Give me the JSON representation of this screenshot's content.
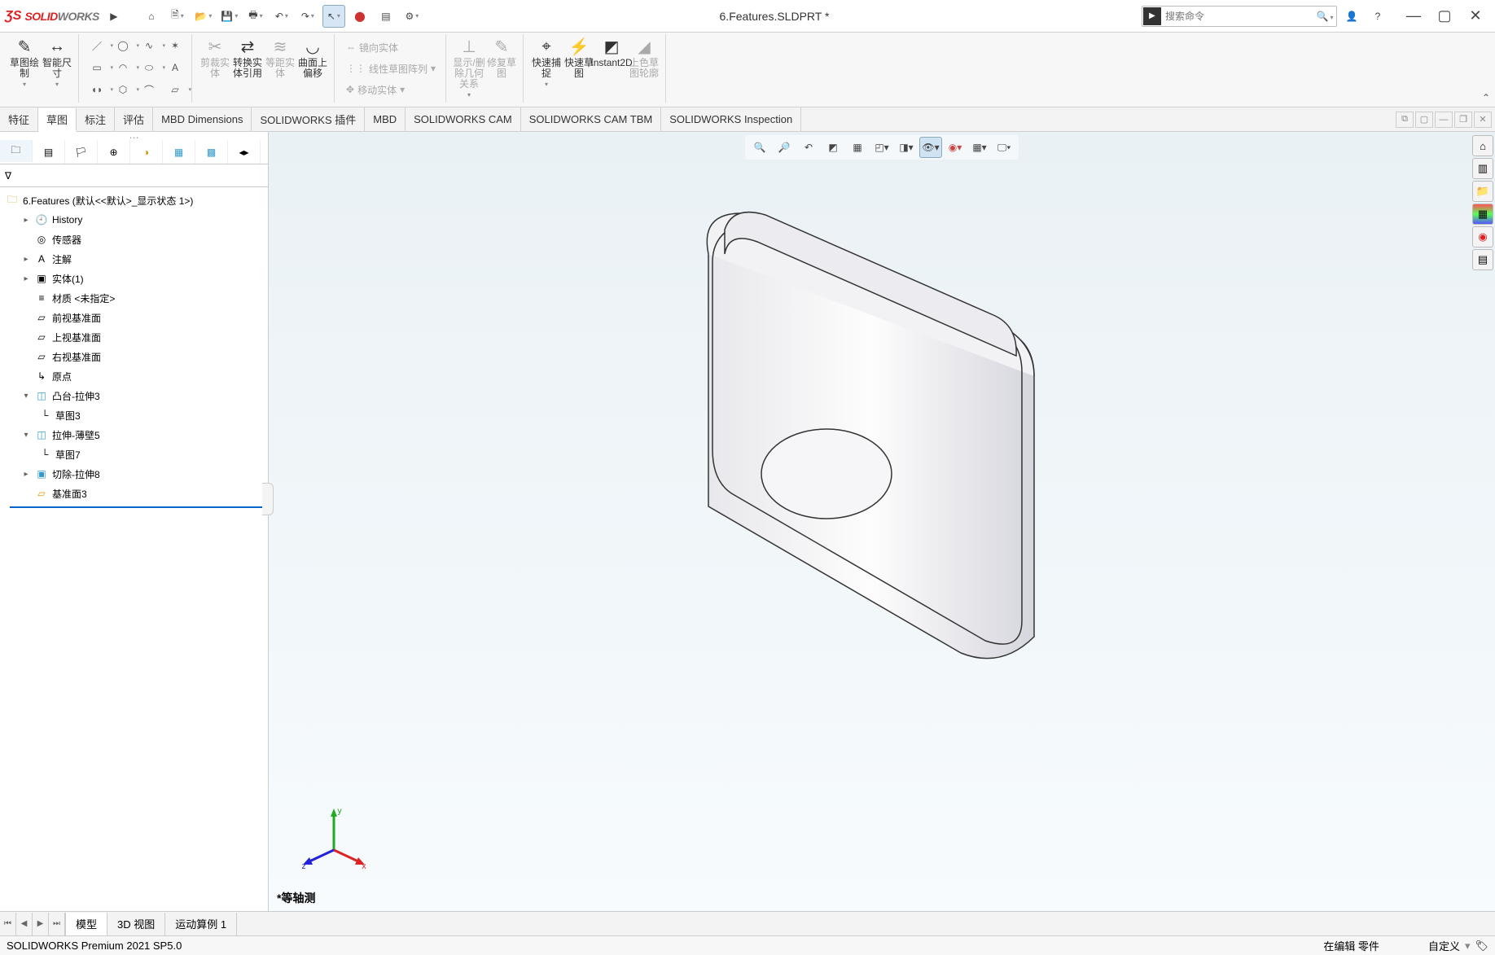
{
  "app_name_1": "SOLID",
  "app_name_2": "WORKS",
  "document_title": "6.Features.SLDPRT *",
  "search_placeholder": "搜索命令",
  "ribbon": {
    "sketch": "草图绘制",
    "smart_dim": "智能尺寸",
    "trim": "剪裁实体",
    "convert": "转换实体引用",
    "offset_ent": "等距实体",
    "curve_offset": "曲面上偏移",
    "mirror": "镜向实体",
    "linear_pattern": "线性草图阵列",
    "move": "移动实体",
    "show_del_rel": "显示/删除几何关系",
    "repair": "修复草图",
    "quick_snap": "快速捕捉",
    "quick_sketch": "快速草图",
    "instant2d": "Instant2D",
    "shade_outline": "上色草图轮廓"
  },
  "tabs": [
    "特征",
    "草图",
    "标注",
    "评估",
    "MBD Dimensions",
    "SOLIDWORKS 插件",
    "MBD",
    "SOLIDWORKS CAM",
    "SOLIDWORKS CAM TBM",
    "SOLIDWORKS Inspection"
  ],
  "tree_root": "6.Features  (默认<<默认>_显示状态 1>)",
  "tree": {
    "history": "History",
    "sensors": "传感器",
    "annotations": "注解",
    "solids": "实体(1)",
    "material": "材质 <未指定>",
    "front": "前视基准面",
    "top": "上视基准面",
    "right": "右视基准面",
    "origin": "原点",
    "boss_extrude3": "凸台-拉伸3",
    "sketch3": "草图3",
    "extrude_thin5": "拉伸-薄壁5",
    "sketch7": "草图7",
    "cut_extrude8": "切除-拉伸8",
    "plane3": "基准面3"
  },
  "view_label": "*等轴测",
  "triad": {
    "x": "x",
    "y": "y",
    "z": "z"
  },
  "bottom_tabs": [
    "模型",
    "3D 视图",
    "运动算例 1"
  ],
  "status_left": "SOLIDWORKS Premium 2021 SP5.0",
  "status_right_1": "在编辑 零件",
  "status_right_2": "自定义"
}
